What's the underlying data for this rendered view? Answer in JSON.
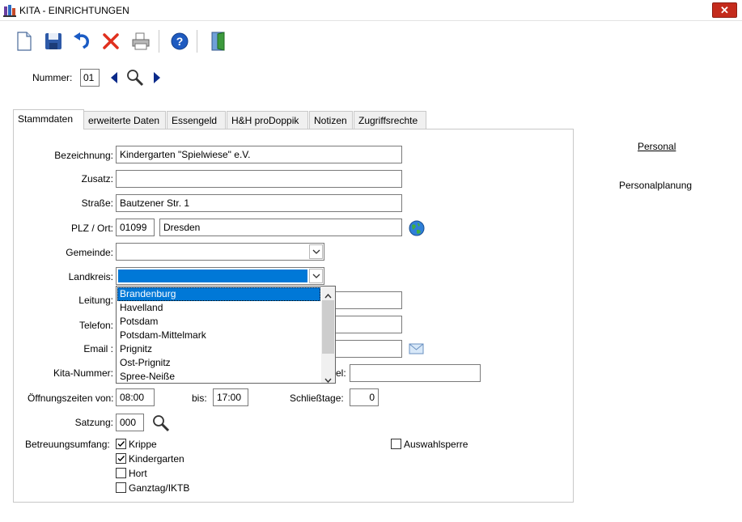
{
  "window": {
    "title": "KITA - EINRICHTUNGEN",
    "close_label": "✕"
  },
  "toolbar": {
    "buttons": [
      "new-icon",
      "save-icon",
      "undo-icon",
      "delete-icon",
      "print-icon",
      "help-icon",
      "exit-door-icon"
    ]
  },
  "nummer": {
    "label": "Nummer:",
    "value": "01"
  },
  "tabs": [
    "Stammdaten",
    "erweiterte Daten",
    "Essengeld",
    "H&H proDoppik",
    "Notizen",
    "Zugriffsrechte"
  ],
  "form": {
    "bezeichnung": {
      "label": "Bezeichnung:",
      "value": "Kindergarten \"Spielwiese\" e.V."
    },
    "zusatz": {
      "label": "Zusatz:",
      "value": ""
    },
    "strasse": {
      "label": "Straße:",
      "value": "Bautzener Str. 1"
    },
    "plz_ort": {
      "label": "PLZ / Ort:",
      "plz": "01099",
      "ort": "Dresden"
    },
    "gemeinde": {
      "label": "Gemeinde:",
      "value": ""
    },
    "landkreis": {
      "label": "Landkreis:",
      "value": ""
    },
    "leitung": {
      "label": "Leitung:"
    },
    "telefon": {
      "label": "Telefon:"
    },
    "email": {
      "label": "Email :"
    },
    "kita_nummer": {
      "label": "Kita-Nummer:",
      "right_label_fragment": "el:"
    },
    "oeffnungszeiten": {
      "label": "Öffnungszeiten von:",
      "von": "08:00",
      "bis_label": "bis:",
      "bis": "17:00"
    },
    "schliesstage": {
      "label": "Schließtage:",
      "value": "0"
    },
    "satzung": {
      "label": "Satzung:",
      "value": "000"
    },
    "betreuungsumfang": {
      "label": "Betreuungsumfang:"
    },
    "checkboxes": [
      {
        "label": "Krippe",
        "checked": true
      },
      {
        "label": "Kindergarten",
        "checked": true
      },
      {
        "label": "Hort",
        "checked": false
      },
      {
        "label": "Ganztag/IKTB",
        "checked": false
      }
    ],
    "auswahlsperre": {
      "label": "Auswahlsperre",
      "checked": false
    }
  },
  "landkreis_options": [
    "Brandenburg",
    "Havelland",
    "Potsdam",
    "Potsdam-Mittelmark",
    "Prignitz",
    "Ost-Prignitz",
    "Spree-Neiße"
  ],
  "side_links": {
    "personal": "Personal",
    "personalplanung": "Personalplanung"
  }
}
